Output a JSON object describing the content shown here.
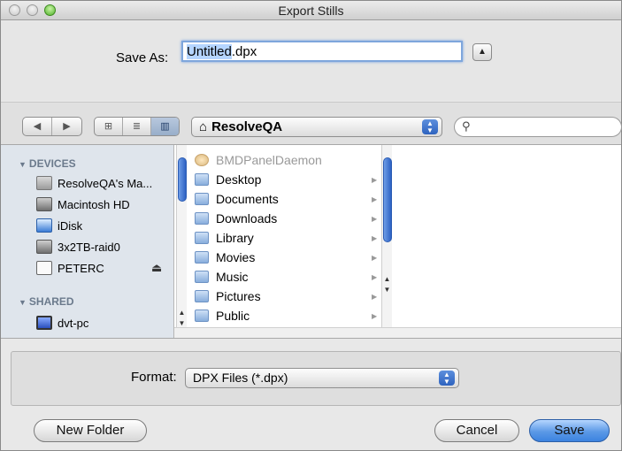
{
  "window": {
    "title": "Export Stills"
  },
  "save_as": {
    "label": "Save As:",
    "filename_base": "Untitled",
    "filename_ext": ".dpx",
    "expand_glyph": "▲"
  },
  "toolbar": {
    "back_glyph": "◀",
    "forward_glyph": "▶",
    "view_icon_glyph": "⊞",
    "view_list_glyph": "≣",
    "view_column_glyph": "▥",
    "location": "ResolveQA",
    "location_icon": "home-icon",
    "search_glyph": "🔍",
    "search_value": ""
  },
  "sidebar": {
    "devices_header": "DEVICES",
    "shared_header": "SHARED",
    "devices": [
      {
        "label": "ResolveQA's Ma...",
        "icon": "computer-icon"
      },
      {
        "label": "Macintosh HD",
        "icon": "hard-drive-icon"
      },
      {
        "label": "iDisk",
        "icon": "idisk-icon"
      },
      {
        "label": "3x2TB-raid0",
        "icon": "hard-drive-icon"
      },
      {
        "label": "PETERC",
        "icon": "external-drive-icon"
      }
    ],
    "eject_glyph": "⏏",
    "shared": [
      {
        "label": "dvt-pc",
        "icon": "pc-icon"
      }
    ]
  },
  "files": [
    {
      "label": "BMDPanelDaemon",
      "dimmed": true
    },
    {
      "label": "Desktop"
    },
    {
      "label": "Documents"
    },
    {
      "label": "Downloads"
    },
    {
      "label": "Library"
    },
    {
      "label": "Movies"
    },
    {
      "label": "Music"
    },
    {
      "label": "Pictures"
    },
    {
      "label": "Public"
    }
  ],
  "format": {
    "label": "Format:",
    "value": "DPX Files (*.dpx)"
  },
  "buttons": {
    "new_folder": "New Folder",
    "cancel": "Cancel",
    "save": "Save"
  },
  "colors": {
    "accent": "#3c83e0",
    "sidebar_bg": "#dfe5ec",
    "dialog_bg": "#e8e8e8"
  }
}
